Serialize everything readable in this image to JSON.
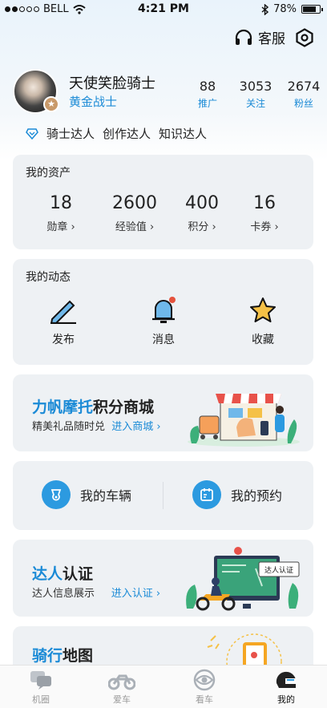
{
  "status_bar": {
    "carrier": "BELL",
    "time": "4:21 PM",
    "battery": "78%",
    "battery_level": 0.78
  },
  "header": {
    "customer_service_label": "客服"
  },
  "profile": {
    "name": "天使笑脸骑士",
    "level": "黄金战士",
    "stats": [
      {
        "num": "88",
        "label": "推广"
      },
      {
        "num": "3053",
        "label": "关注"
      },
      {
        "num": "2674",
        "label": "粉丝"
      }
    ]
  },
  "tags": [
    "骑士达人",
    "创作达人",
    "知识达人"
  ],
  "assets": {
    "title": "我的资产",
    "items": [
      {
        "num": "18",
        "label": "勋章 ›"
      },
      {
        "num": "2600",
        "label": "经验值 ›"
      },
      {
        "num": "400",
        "label": "积分 ›"
      },
      {
        "num": "16",
        "label": "卡券 ›"
      }
    ]
  },
  "dynamics": {
    "title": "我的动态",
    "items": [
      {
        "label": "发布",
        "icon": "pen-icon"
      },
      {
        "label": "消息",
        "icon": "bell-icon"
      },
      {
        "label": "收藏",
        "icon": "star-icon"
      }
    ]
  },
  "mall": {
    "title_highlight": "力帆摩托",
    "title_rest": "积分商城",
    "subtitle": "精美礼品随时兑",
    "link": "进入商城 ›"
  },
  "vehicle": {
    "my_vehicle": "我的车辆",
    "my_booking": "我的预约"
  },
  "expert": {
    "title_highlight": "达人",
    "title_rest": "认证",
    "subtitle": "达人信息展示",
    "link": "进入认证 ›",
    "illustration_sign": "达人认证"
  },
  "map": {
    "title_highlight": "骑行",
    "title_rest": "地图"
  },
  "tabbar": [
    {
      "label": "机圈",
      "icon": "chat-icon"
    },
    {
      "label": "爱车",
      "icon": "motorcycle-icon"
    },
    {
      "label": "看车",
      "icon": "eye-icon"
    },
    {
      "label": "我的",
      "icon": "helmet-icon"
    }
  ],
  "colors": {
    "accent": "#1a8ad6",
    "card_bg": "#eef1f4",
    "notify": "#e5533d"
  }
}
